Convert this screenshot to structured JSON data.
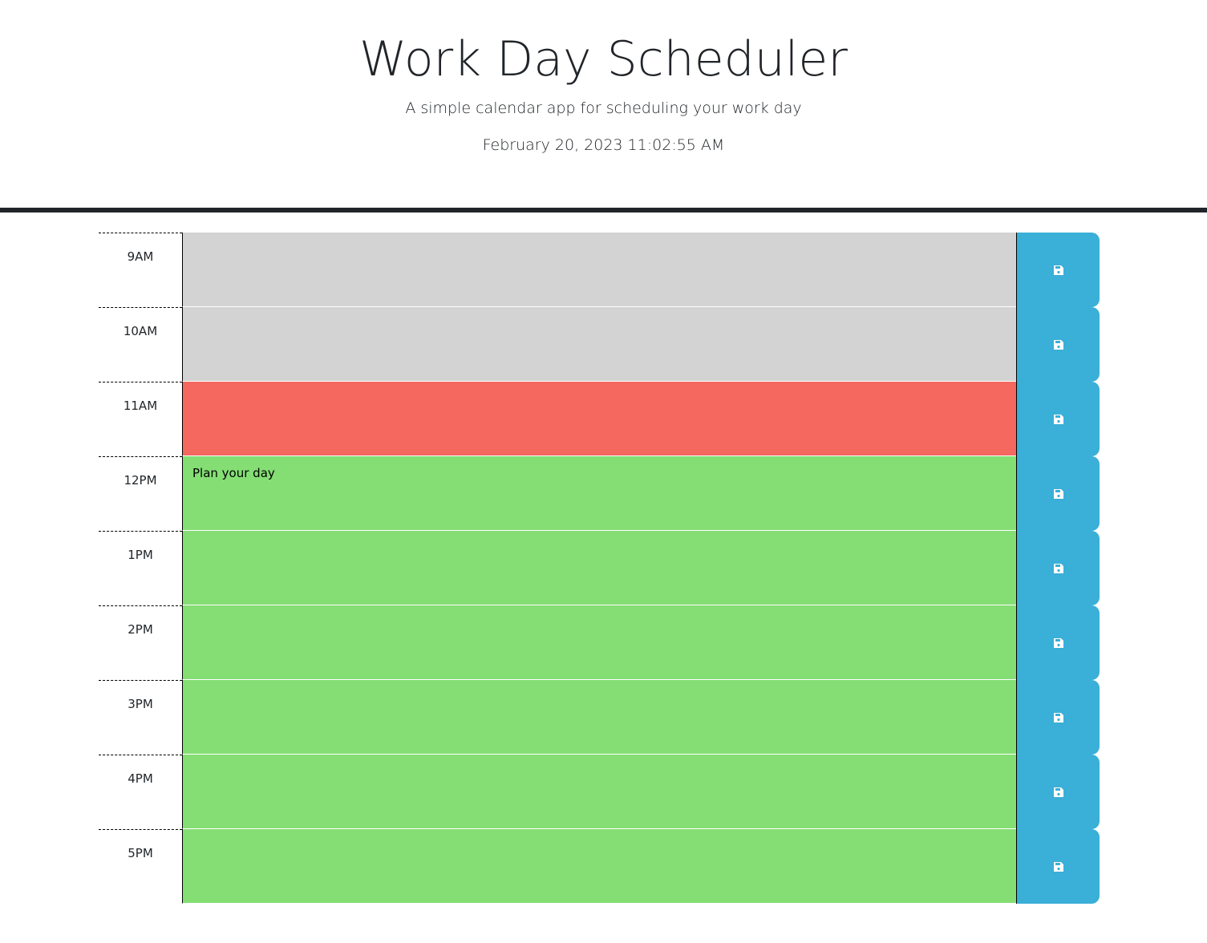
{
  "header": {
    "title": "Work Day Scheduler",
    "subtitle": "A simple calendar app for scheduling your work day",
    "current_datetime": "February 20, 2023 11:02:55 AM"
  },
  "colors": {
    "past": "#d3d3d3",
    "present": "#f4685f",
    "future": "#84de74",
    "save_button": "#3aafd7"
  },
  "time_blocks": [
    {
      "hour": "9AM",
      "state": "past",
      "text": "",
      "placeholder": "",
      "icon": "floppy-disk-icon"
    },
    {
      "hour": "10AM",
      "state": "past",
      "text": "",
      "placeholder": "",
      "icon": "floppy-disk-icon"
    },
    {
      "hour": "11AM",
      "state": "present",
      "text": "",
      "placeholder": "",
      "icon": "floppy-disk-icon"
    },
    {
      "hour": "12PM",
      "state": "future",
      "text": "",
      "placeholder": "Plan your day",
      "icon": "floppy-disk-icon"
    },
    {
      "hour": "1PM",
      "state": "future",
      "text": "",
      "placeholder": "",
      "icon": "floppy-disk-icon"
    },
    {
      "hour": "2PM",
      "state": "future",
      "text": "",
      "placeholder": "",
      "icon": "floppy-disk-icon"
    },
    {
      "hour": "3PM",
      "state": "future",
      "text": "",
      "placeholder": "",
      "icon": "floppy-disk-icon"
    },
    {
      "hour": "4PM",
      "state": "future",
      "text": "",
      "placeholder": "",
      "icon": "floppy-disk-icon"
    },
    {
      "hour": "5PM",
      "state": "future",
      "text": "",
      "placeholder": "",
      "icon": "floppy-disk-icon"
    }
  ]
}
